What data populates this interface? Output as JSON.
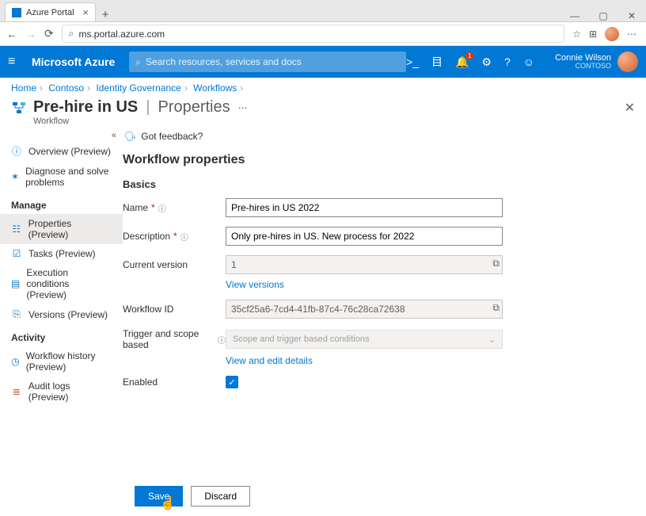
{
  "browser": {
    "tab_title": "Azure Portal",
    "url": "ms.portal.azure.com"
  },
  "topbar": {
    "brand": "Microsoft Azure",
    "search_placeholder": "Search resources, services and docs",
    "notification_count": "1",
    "user_name": "Connie Wilson",
    "user_org": "CONTOSO"
  },
  "breadcrumb": [
    "Home",
    "Contoso",
    "Identity Governance",
    "Workflows"
  ],
  "header": {
    "title": "Pre-hire in US",
    "subpage": "Properties",
    "subtitle": "Workflow"
  },
  "nav": {
    "top": [
      {
        "icon": "info-icon",
        "label": "Overview (Preview)",
        "color": "ic-blue"
      },
      {
        "icon": "diagnose-icon",
        "label": "Diagnose and solve problems",
        "color": "ic-blue"
      }
    ],
    "manage_head": "Manage",
    "manage": [
      {
        "icon": "properties-icon",
        "label": "Properties (Preview)",
        "color": "ic-blue",
        "active": true
      },
      {
        "icon": "tasks-icon",
        "label": "Tasks (Preview)",
        "color": "ic-blue"
      },
      {
        "icon": "conditions-icon",
        "label": "Execution conditions (Preview)",
        "color": "ic-blue"
      },
      {
        "icon": "versions-icon",
        "label": "Versions (Preview)",
        "color": "ic-blue"
      }
    ],
    "activity_head": "Activity",
    "activity": [
      {
        "icon": "history-icon",
        "label": "Workflow history (Preview)",
        "color": "ic-blue"
      },
      {
        "icon": "audit-icon",
        "label": "Audit logs (Preview)",
        "color": "ic-orange"
      }
    ]
  },
  "main": {
    "feedback": "Got feedback?",
    "section_title": "Workflow properties",
    "basics_head": "Basics",
    "labels": {
      "name": "Name",
      "description": "Description",
      "current_version": "Current version",
      "workflow_id": "Workflow ID",
      "trigger": "Trigger and scope based",
      "enabled": "Enabled"
    },
    "values": {
      "name": "Pre-hires in US 2022",
      "description": "Only pre-hires in US. New process for 2022",
      "current_version": "1",
      "workflow_id": "35cf25a6-7cd4-41fb-87c4-76c28ca72638",
      "trigger_placeholder": "Scope and trigger based conditions"
    },
    "links": {
      "view_versions": "View versions",
      "view_edit": "View and edit details"
    },
    "buttons": {
      "save": "Save",
      "discard": "Discard"
    }
  }
}
